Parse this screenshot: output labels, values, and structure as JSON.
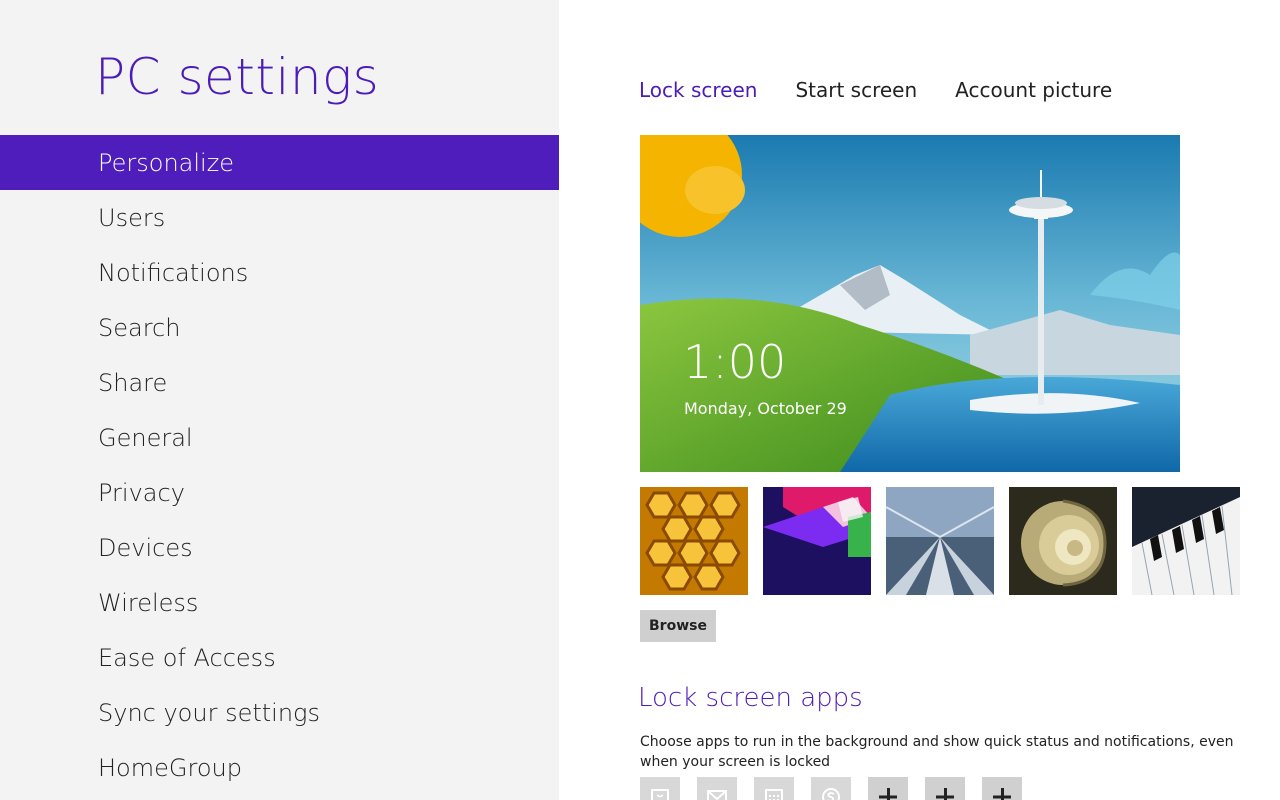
{
  "app": {
    "title": "PC settings"
  },
  "nav": {
    "items": [
      {
        "label": "Personalize",
        "active": true
      },
      {
        "label": "Users"
      },
      {
        "label": "Notifications"
      },
      {
        "label": "Search"
      },
      {
        "label": "Share"
      },
      {
        "label": "General"
      },
      {
        "label": "Privacy"
      },
      {
        "label": "Devices"
      },
      {
        "label": "Wireless"
      },
      {
        "label": "Ease of Access"
      },
      {
        "label": "Sync your settings"
      },
      {
        "label": "HomeGroup"
      }
    ]
  },
  "tabs": [
    {
      "label": "Lock screen",
      "active": true
    },
    {
      "label": "Start screen"
    },
    {
      "label": "Account picture"
    }
  ],
  "preview": {
    "time": "1:00",
    "date": "Monday, October 29"
  },
  "thumbnails": [
    "honeycomb",
    "abstract-cubes",
    "tunnel-rails",
    "nautilus-shell",
    "piano-keys"
  ],
  "browse_label": "Browse",
  "lock_apps": {
    "title": "Lock screen apps",
    "description": "Choose apps to run in the background and show quick status and notifications, even when your screen is locked",
    "slots": [
      {
        "icon": "messaging-icon"
      },
      {
        "icon": "mail-icon"
      },
      {
        "icon": "calendar-icon"
      },
      {
        "icon": "skype-icon"
      },
      {
        "icon": "add-icon"
      },
      {
        "icon": "add-icon"
      },
      {
        "icon": "add-icon"
      }
    ]
  },
  "colors": {
    "accent": "#4e1dbb",
    "left_bg": "#f3f3f3"
  }
}
